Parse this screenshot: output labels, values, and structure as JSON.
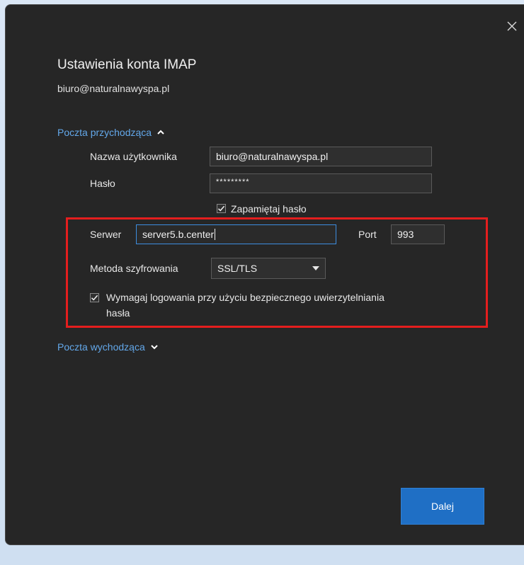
{
  "dialog": {
    "title": "Ustawienia konta IMAP",
    "subtitle": "biuro@naturalnawyspa.pl"
  },
  "incoming": {
    "header": "Poczta przychodząca",
    "username_label": "Nazwa użytkownika",
    "username_value": "biuro@naturalnawyspa.pl",
    "password_label": "Hasło",
    "password_value": "*********",
    "remember_label": "Zapamiętaj hasło",
    "remember_checked": true,
    "server_label": "Serwer",
    "server_value": "server5.b.center",
    "port_label": "Port",
    "port_value": "993",
    "encryption_label": "Metoda szyfrowania",
    "encryption_value": "SSL/TLS",
    "spa_label_line1": "Wymagaj logowania przy użyciu bezpiecznego uwierzytelniania",
    "spa_label_line2": "hasła",
    "spa_checked": true
  },
  "outgoing": {
    "header": "Poczta wychodząca"
  },
  "actions": {
    "next_label": "Dalej"
  },
  "colors": {
    "dialog_background": "#262626",
    "link_blue": "#63a8ea",
    "primary_button": "#1f6fc5",
    "highlight_red": "#e41e1e",
    "focus_border": "#3d8ee0"
  },
  "icons": {
    "close": "close-icon",
    "chevron_up": "chevron-up-icon",
    "chevron_down": "chevron-down-icon",
    "checkmark": "checkmark-icon",
    "dropdown_arrow": "dropdown-arrow-icon"
  }
}
